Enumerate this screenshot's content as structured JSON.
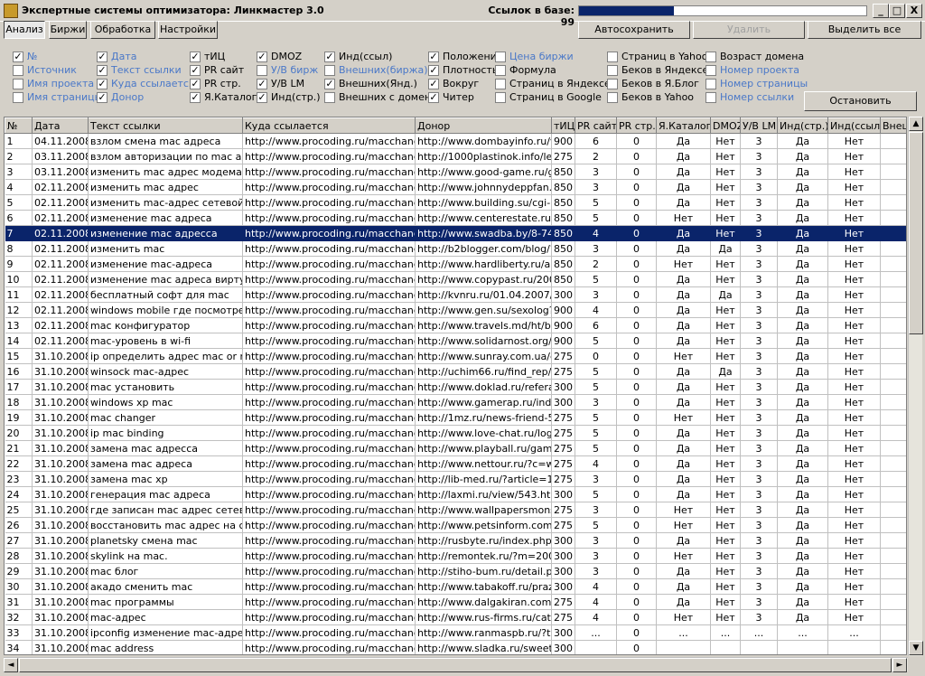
{
  "window": {
    "title": "Экспертные системы оптимизатора: Линкмастер 3.0",
    "links_in_base": "Ссылок в базе: 99",
    "progress_fraction": 0.33,
    "minimize": "_",
    "maximize": "□",
    "close": "X"
  },
  "tabs": [
    "Анализ",
    "Биржи",
    "Обработка",
    "Настройки"
  ],
  "top_buttons": {
    "autosave": "Автосохранить",
    "delete": "Удалить",
    "select_all": "Выделить все"
  },
  "stop_button": "Остановить",
  "filters": [
    {
      "label": "№",
      "checked": true,
      "blue": true
    },
    {
      "label": "Источник",
      "checked": false,
      "blue": true
    },
    {
      "label": "Имя проекта",
      "checked": false,
      "blue": true
    },
    {
      "label": "Имя страницы",
      "checked": false,
      "blue": true
    },
    {
      "label": "Дата",
      "checked": true,
      "blue": true
    },
    {
      "label": "Текст ссылки",
      "checked": true,
      "blue": true
    },
    {
      "label": "Куда ссылается",
      "checked": true,
      "blue": true
    },
    {
      "label": "Донор",
      "checked": true,
      "blue": true
    },
    {
      "label": "тИЦ",
      "checked": true,
      "blue": false
    },
    {
      "label": "PR сайт",
      "checked": true,
      "blue": false
    },
    {
      "label": "PR стр.",
      "checked": true,
      "blue": false
    },
    {
      "label": "Я.Каталог",
      "checked": true,
      "blue": false
    },
    {
      "label": "DMOZ",
      "checked": true,
      "blue": false
    },
    {
      "label": "У/В бирж",
      "checked": false,
      "blue": true
    },
    {
      "label": "У/В LM",
      "checked": true,
      "blue": false
    },
    {
      "label": "Инд(стр.)",
      "checked": true,
      "blue": false
    },
    {
      "label": "Инд(ссыл)",
      "checked": true,
      "blue": false
    },
    {
      "label": "Внешних(биржа)",
      "checked": false,
      "blue": true
    },
    {
      "label": "Внешних(Янд.)",
      "checked": true,
      "blue": false
    },
    {
      "label": "Внешних с домена",
      "checked": false,
      "blue": false
    },
    {
      "label": "Положение",
      "checked": true,
      "blue": false
    },
    {
      "label": "Плотность",
      "checked": true,
      "blue": false
    },
    {
      "label": "Вокруг",
      "checked": true,
      "blue": false
    },
    {
      "label": "Читер",
      "checked": true,
      "blue": false
    },
    {
      "label": "Цена биржи",
      "checked": false,
      "blue": true
    },
    {
      "label": "Формула",
      "checked": false,
      "blue": false
    },
    {
      "label": "Страниц в Яндексе",
      "checked": false,
      "blue": false
    },
    {
      "label": "Страниц в Google",
      "checked": false,
      "blue": false
    },
    {
      "label": "Страниц в Yahoo",
      "checked": false,
      "blue": false
    },
    {
      "label": "Беков в Яндексе",
      "checked": false,
      "blue": false
    },
    {
      "label": "Беков в Я.Блог",
      "checked": false,
      "blue": false
    },
    {
      "label": "Беков в Yahoo",
      "checked": false,
      "blue": false
    },
    {
      "label": "Возраст домена",
      "checked": false,
      "blue": false
    },
    {
      "label": "Номер проекта",
      "checked": false,
      "blue": true
    },
    {
      "label": "Номер страницы",
      "checked": false,
      "blue": true
    },
    {
      "label": "Номер ссылки",
      "checked": false,
      "blue": true
    }
  ],
  "table": {
    "columns": [
      "№",
      "Дата",
      "Текст ссылки",
      "Куда ссылается",
      "Донор",
      "тИЦ",
      "PR сайт",
      "PR стр.",
      "Я.Каталог",
      "DMOZ",
      "У/В LM",
      "Инд(стр.)",
      "Инд(ссыл)",
      "Внеш"
    ],
    "selected_row": 6,
    "rows": [
      [
        "1",
        "04.11.2008",
        "взлом смена mac адреса",
        "http://www.procoding.ru/macchange/",
        "http://www.dombayinfo.ru/vie",
        "900",
        "6",
        "0",
        "Да",
        "Нет",
        "3",
        "Да",
        "Нет",
        ""
      ],
      [
        "2",
        "03.11.2008",
        "взлом авторизации по mac адресу",
        "http://www.procoding.ru/macchange/",
        "http://1000plastinok.info/let_s",
        "275",
        "2",
        "0",
        "Да",
        "Нет",
        "3",
        "Да",
        "Нет",
        ""
      ],
      [
        "3",
        "03.11.2008",
        "изменить mac адрес модема",
        "http://www.procoding.ru/macchange/",
        "http://www.good-game.ru/gam",
        "850",
        "3",
        "0",
        "Да",
        "Нет",
        "3",
        "Да",
        "Нет",
        ""
      ],
      [
        "4",
        "02.11.2008",
        "изменить mac адрес",
        "http://www.procoding.ru/macchange/",
        "http://www.johnnydeppfan.ru/",
        "850",
        "3",
        "0",
        "Да",
        "Нет",
        "3",
        "Да",
        "Нет",
        ""
      ],
      [
        "5",
        "02.11.2008",
        "изменить mac-адрес сетевой карты",
        "http://www.procoding.ru/macchange/",
        "http://www.building.su/cgi-bin",
        "850",
        "5",
        "0",
        "Да",
        "Нет",
        "3",
        "Да",
        "Нет",
        ""
      ],
      [
        "6",
        "02.11.2008",
        "изменение mac адреса",
        "http://www.procoding.ru/macchange/",
        "http://www.centerestate.ru/ag",
        "850",
        "5",
        "0",
        "Нет",
        "Нет",
        "3",
        "Да",
        "Нет",
        ""
      ],
      [
        "7",
        "02.11.2008",
        "изменение mac адресса",
        "http://www.procoding.ru/macchange/",
        "http://www.swadba.by/8-742.",
        "850",
        "4",
        "0",
        "Да",
        "Нет",
        "3",
        "Да",
        "Нет",
        ""
      ],
      [
        "8",
        "02.11.2008",
        "изменить mac",
        "http://www.procoding.ru/macchange/",
        "http://b2blogger.com/blog/?m=",
        "850",
        "3",
        "0",
        "Да",
        "Да",
        "3",
        "Да",
        "Нет",
        ""
      ],
      [
        "9",
        "02.11.2008",
        "изменение mac-адреса",
        "http://www.procoding.ru/macchange/",
        "http://www.hardliberty.ru/artic",
        "850",
        "2",
        "0",
        "Нет",
        "Нет",
        "3",
        "Да",
        "Нет",
        ""
      ],
      [
        "10",
        "02.11.2008",
        "изменение mac адреса виртуальной",
        "http://www.procoding.ru/macchange/",
        "http://www.copypast.ru/2008/",
        "850",
        "5",
        "0",
        "Да",
        "Нет",
        "3",
        "Да",
        "Нет",
        ""
      ],
      [
        "11",
        "02.11.2008",
        "бесплатный софт для mac",
        "http://www.procoding.ru/macchange/",
        "http://kvnru.ru/01.04.2007/1/c",
        "300",
        "3",
        "0",
        "Да",
        "Да",
        "3",
        "Да",
        "Нет",
        ""
      ],
      [
        "12",
        "02.11.2008",
        "windows mobile где посмотреть mac",
        "http://www.procoding.ru/macchange/",
        "http://www.gen.su/sexolog?pa",
        "900",
        "4",
        "0",
        "Да",
        "Нет",
        "3",
        "Да",
        "Нет",
        ""
      ],
      [
        "13",
        "02.11.2008",
        "mac конфигуратор",
        "http://www.procoding.ru/macchange/",
        "http://www.travels.md/ht/bg/a",
        "900",
        "6",
        "0",
        "Да",
        "Нет",
        "3",
        "Да",
        "Нет",
        ""
      ],
      [
        "14",
        "02.11.2008",
        "mac-уровень в wi-fi",
        "http://www.procoding.ru/macchange/",
        "http://www.solidarnost.org/art",
        "900",
        "5",
        "0",
        "Да",
        "Нет",
        "3",
        "Да",
        "Нет",
        ""
      ],
      [
        "15",
        "31.10.2008",
        "ip определить адрес mac or mak",
        "http://www.procoding.ru/macchange/",
        "http://www.sunray.com.ua/de",
        "275",
        "0",
        "0",
        "Нет",
        "Нет",
        "3",
        "Да",
        "Нет",
        ""
      ],
      [
        "16",
        "31.10.2008",
        "winsock mac-адрес",
        "http://www.procoding.ru/macchange/",
        "http://uchim66.ru/find_rep/sho",
        "275",
        "5",
        "0",
        "Да",
        "Да",
        "3",
        "Да",
        "Нет",
        ""
      ],
      [
        "17",
        "31.10.2008",
        "mac установить",
        "http://www.procoding.ru/macchange/",
        "http://www.doklad.ru/referat.p",
        "300",
        "5",
        "0",
        "Да",
        "Нет",
        "3",
        "Да",
        "Нет",
        ""
      ],
      [
        "18",
        "31.10.2008",
        "windows xp mac",
        "http://www.procoding.ru/macchange/",
        "http://www.gamerap.ru/index.",
        "300",
        "3",
        "0",
        "Да",
        "Нет",
        "3",
        "Да",
        "Нет",
        ""
      ],
      [
        "19",
        "31.10.2008",
        "mac changer",
        "http://www.procoding.ru/macchange/",
        "http://1mz.ru/news-friend-5.ht",
        "275",
        "5",
        "0",
        "Нет",
        "Нет",
        "3",
        "Да",
        "Нет",
        ""
      ],
      [
        "20",
        "31.10.2008",
        "ip mac binding",
        "http://www.procoding.ru/macchange/",
        "http://www.love-chat.ru/log-ch",
        "275",
        "5",
        "0",
        "Да",
        "Нет",
        "3",
        "Да",
        "Нет",
        ""
      ],
      [
        "21",
        "31.10.2008",
        "замена mac адресса",
        "http://www.procoding.ru/macchange/",
        "http://www.playball.ru/games.",
        "275",
        "5",
        "0",
        "Да",
        "Нет",
        "3",
        "Да",
        "Нет",
        ""
      ],
      [
        "22",
        "31.10.2008",
        "замена mac адреса",
        "http://www.procoding.ru/macchange/",
        "http://www.nettour.ru/?c=wea",
        "275",
        "4",
        "0",
        "Да",
        "Нет",
        "3",
        "Да",
        "Нет",
        ""
      ],
      [
        "23",
        "31.10.2008",
        "замена mac xp",
        "http://www.procoding.ru/macchange/",
        "http://lib-med.ru/?article=1405",
        "275",
        "3",
        "0",
        "Да",
        "Нет",
        "3",
        "Да",
        "Нет",
        ""
      ],
      [
        "24",
        "31.10.2008",
        "генерация mac адреса",
        "http://www.procoding.ru/macchange/",
        "http://laxmi.ru/view/543.html",
        "300",
        "5",
        "0",
        "Да",
        "Нет",
        "3",
        "Да",
        "Нет",
        ""
      ],
      [
        "25",
        "31.10.2008",
        "где записан mac адрес сетевой карты",
        "http://www.procoding.ru/macchange/",
        "http://www.wallpapersmonster",
        "275",
        "3",
        "0",
        "Нет",
        "Нет",
        "3",
        "Да",
        "Нет",
        ""
      ],
      [
        "26",
        "31.10.2008",
        "восстановить mac адрес на сетевой",
        "http://www.procoding.ru/macchange/",
        "http://www.petsinform.com/ca",
        "275",
        "5",
        "0",
        "Нет",
        "Нет",
        "3",
        "Да",
        "Нет",
        ""
      ],
      [
        "27",
        "31.10.2008",
        "planetsky смена mac",
        "http://www.procoding.ru/macchange/",
        "http://rusbyte.ru/index.php?pr",
        "300",
        "3",
        "0",
        "Да",
        "Нет",
        "3",
        "Да",
        "Нет",
        ""
      ],
      [
        "28",
        "31.10.2008",
        "skylink на mac.",
        "http://www.procoding.ru/macchange/",
        "http://remontek.ru/?m=200808",
        "300",
        "3",
        "0",
        "Нет",
        "Нет",
        "3",
        "Да",
        "Нет",
        ""
      ],
      [
        "29",
        "31.10.2008",
        "mac блог",
        "http://www.procoding.ru/macchange/",
        "http://stiho-bum.ru/detail.php?",
        "300",
        "3",
        "0",
        "Да",
        "Нет",
        "3",
        "Да",
        "Нет",
        ""
      ],
      [
        "30",
        "31.10.2008",
        "акадо сменить mac",
        "http://www.procoding.ru/macchange/",
        "http://www.tabakoff.ru/prazdn",
        "300",
        "4",
        "0",
        "Да",
        "Нет",
        "3",
        "Да",
        "Нет",
        ""
      ],
      [
        "31",
        "31.10.2008",
        "mac программы",
        "http://www.procoding.ru/macchange/",
        "http://www.dalgakiran.com.ua",
        "275",
        "4",
        "0",
        "Да",
        "Нет",
        "3",
        "Да",
        "Нет",
        ""
      ],
      [
        "32",
        "31.10.2008",
        "mac-адрес",
        "http://www.procoding.ru/macchange/",
        "http://www.rus-firms.ru/catalo",
        "275",
        "4",
        "0",
        "Нет",
        "Нет",
        "3",
        "Да",
        "Нет",
        ""
      ],
      [
        "33",
        "31.10.2008",
        "ipconfig изменение mac-адресов",
        "http://www.procoding.ru/macchange/",
        "http://www.ranmaspb.ru/?t=a",
        "300",
        "...",
        "0",
        "...",
        "...",
        "...",
        "...",
        "...",
        ""
      ],
      [
        "34",
        "31.10.2008",
        "mac address",
        "http://www.procoding.ru/macchange/",
        "http://www.sladka.ru/sweets/c",
        "300",
        "",
        "0",
        "",
        "",
        "",
        "",
        "",
        ""
      ]
    ]
  }
}
